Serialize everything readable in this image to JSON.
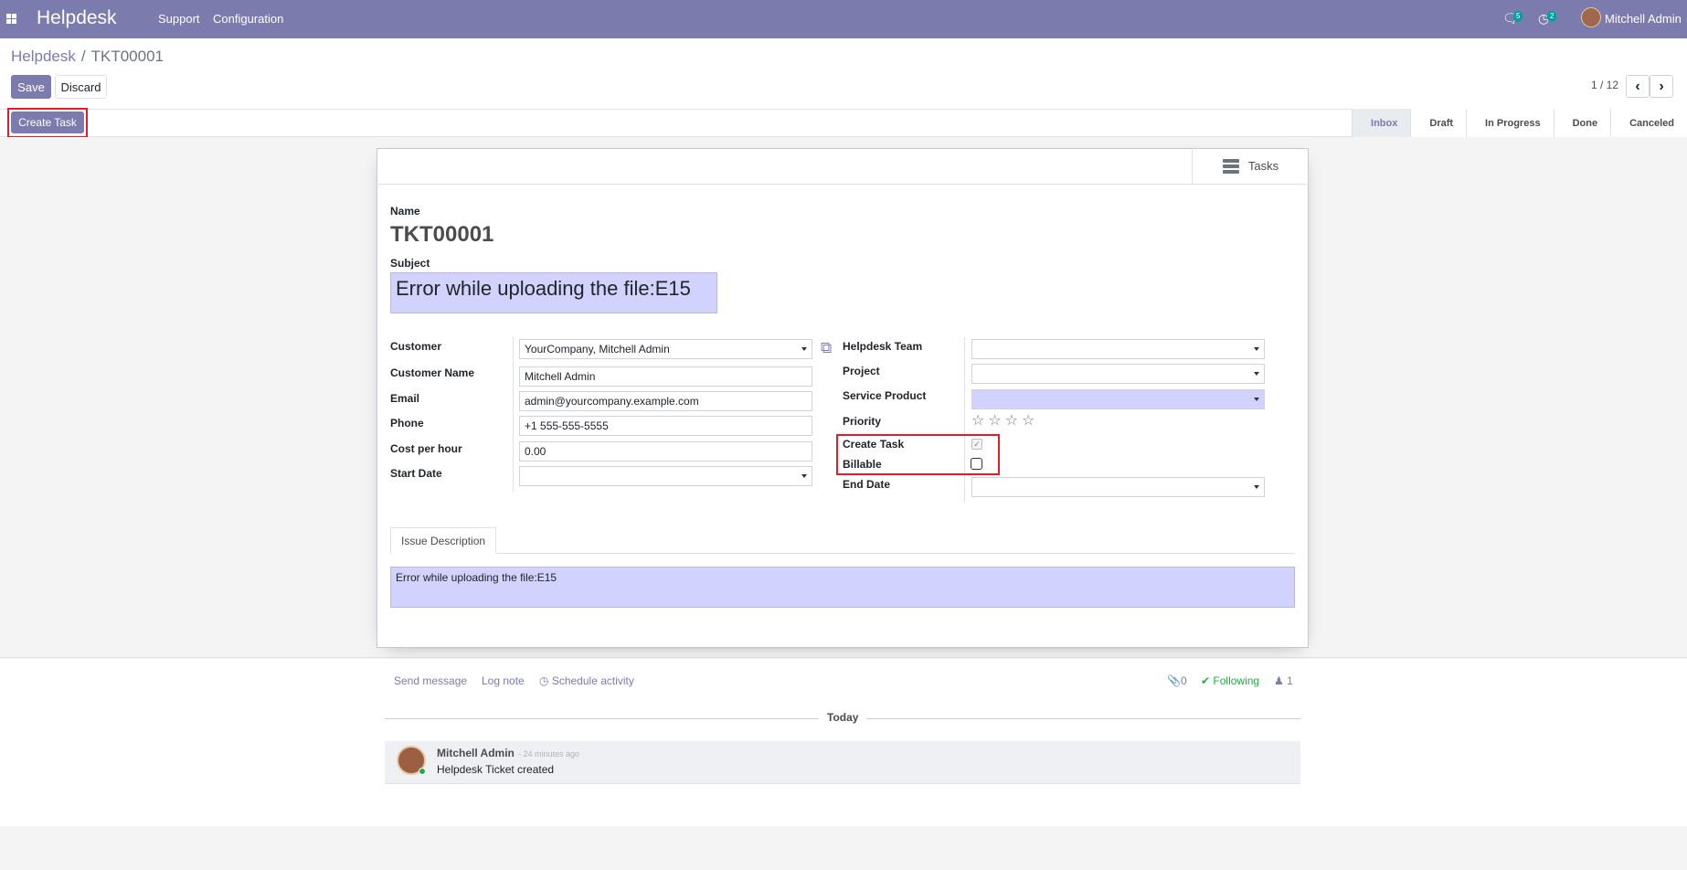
{
  "navbar": {
    "brand": "Helpdesk",
    "menu": [
      "Support",
      "Configuration"
    ],
    "messages_count": "5",
    "activities_count": "2",
    "user_name": "Mitchell Admin"
  },
  "breadcrumb": {
    "parent": "Helpdesk",
    "separator": "/",
    "current": "TKT00001"
  },
  "buttons": {
    "save": "Save",
    "discard": "Discard",
    "create_task": "Create Task"
  },
  "pager": {
    "value": "1 / 12"
  },
  "stages": [
    {
      "label": "Inbox",
      "active": true
    },
    {
      "label": "Draft",
      "active": false
    },
    {
      "label": "In Progress",
      "active": false
    },
    {
      "label": "Done",
      "active": false
    },
    {
      "label": "Canceled",
      "active": false
    }
  ],
  "smart_buttons": {
    "tasks": "Tasks"
  },
  "form": {
    "name_label": "Name",
    "name_value": "TKT00001",
    "subject_label": "Subject",
    "subject_value": "Error while uploading the file:E15",
    "left": {
      "customer": {
        "label": "Customer",
        "value": "YourCompany, Mitchell Admin"
      },
      "customer_name": {
        "label": "Customer Name",
        "value": "Mitchell Admin"
      },
      "email": {
        "label": "Email",
        "value": "admin@yourcompany.example.com"
      },
      "phone": {
        "label": "Phone",
        "value": "+1 555-555-5555"
      },
      "cost_per_hour": {
        "label": "Cost per hour",
        "value": "0.00"
      },
      "start_date": {
        "label": "Start Date",
        "value": ""
      }
    },
    "right": {
      "helpdesk_team": {
        "label": "Helpdesk Team",
        "value": ""
      },
      "project": {
        "label": "Project",
        "value": ""
      },
      "service_product": {
        "label": "Service Product",
        "value": ""
      },
      "priority": {
        "label": "Priority",
        "stars_total": 4,
        "stars_filled": 0
      },
      "create_task": {
        "label": "Create Task",
        "checked": true
      },
      "billable": {
        "label": "Billable",
        "checked": false
      },
      "end_date": {
        "label": "End Date",
        "value": ""
      }
    },
    "tabs": [
      {
        "label": "Issue Description"
      }
    ],
    "description": "Error while uploading the file:E15"
  },
  "chatter": {
    "send_message": "Send message",
    "log_note": "Log note",
    "schedule_activity": "Schedule activity",
    "attachments_count": "0",
    "following": "Following",
    "followers_count": "1",
    "today": "Today",
    "messages": [
      {
        "author": "Mitchell Admin",
        "time": "- 24 minutes ago",
        "body": "Helpdesk Ticket created"
      }
    ]
  },
  "colors": {
    "brand": "#7c7bad",
    "required_field": "#d2d2ff",
    "highlight": "#e11d2c",
    "following": "#28a745"
  }
}
